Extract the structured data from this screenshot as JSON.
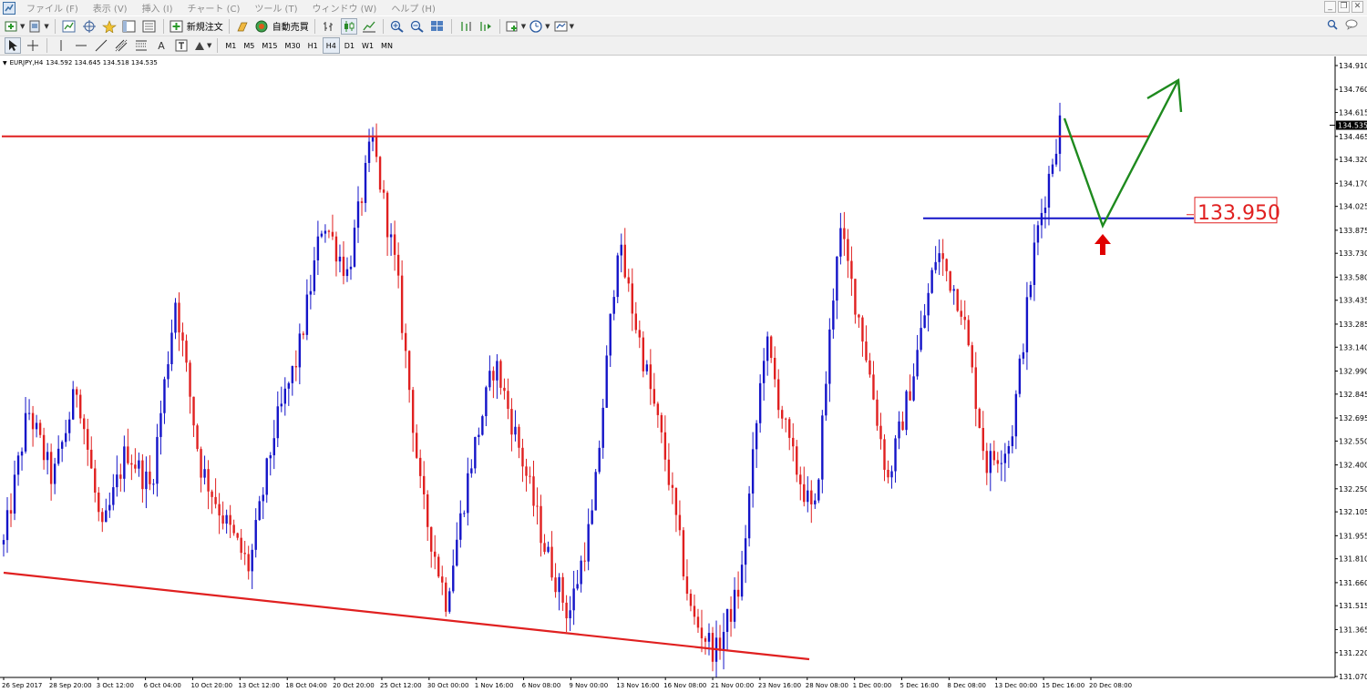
{
  "menu": {
    "items": [
      "ファイル (F)",
      "表示 (V)",
      "挿入 (I)",
      "チャート (C)",
      "ツール (T)",
      "ウィンドウ (W)",
      "ヘルプ (H)"
    ]
  },
  "toolbar1": {
    "new_order_label": "新規注文",
    "auto_trade_label": "自動売買"
  },
  "toolbar2": {
    "timeframes": [
      "M1",
      "M5",
      "M15",
      "M30",
      "H1",
      "H4",
      "D1",
      "W1",
      "MN"
    ],
    "active_timeframe": "H4",
    "text_tool_label": "A"
  },
  "chart_data": {
    "type": "candlestick",
    "symbol_label": "EURJPY,H4",
    "ohlc_label": "134.592 134.645 134.518 134.535",
    "current_price_label": "134.535",
    "current_price": 134.535,
    "price_axis_labels": [
      "134.910",
      "134.760",
      "134.615",
      "134.465",
      "134.320",
      "134.170",
      "134.025",
      "133.875",
      "133.730",
      "133.580",
      "133.435",
      "133.285",
      "133.140",
      "132.990",
      "132.845",
      "132.695",
      "132.550",
      "132.400",
      "132.250",
      "132.105",
      "131.955",
      "131.810",
      "131.660",
      "131.515",
      "131.365",
      "131.220",
      "131.070"
    ],
    "ylim": [
      131.07,
      134.91
    ],
    "time_axis_labels": [
      "26 Sep 2017",
      "28 Sep 20:00",
      "3 Oct 12:00",
      "6 Oct 04:00",
      "10 Oct 20:00",
      "13 Oct 12:00",
      "18 Oct 04:00",
      "20 Oct 20:00",
      "25 Oct 12:00",
      "30 Oct 00:00",
      "1 Nov 16:00",
      "6 Nov 08:00",
      "9 Nov 00:00",
      "13 Nov 16:00",
      "16 Nov 08:00",
      "21 Nov 00:00",
      "23 Nov 16:00",
      "28 Nov 08:00",
      "1 Dec 00:00",
      "5 Dec 16:00",
      "8 Dec 08:00",
      "13 Dec 00:00",
      "15 Dec 16:00",
      "20 Dec 08:00"
    ],
    "waypoints": [
      131.9,
      132.75,
      132.3,
      132.9,
      131.95,
      132.5,
      132.25,
      133.45,
      132.4,
      132.05,
      131.75,
      132.6,
      133.1,
      133.95,
      133.6,
      134.45,
      133.6,
      132.2,
      131.55,
      132.4,
      133.05,
      132.5,
      131.9,
      131.45,
      132.1,
      133.8,
      133.1,
      132.4,
      131.45,
      131.22,
      131.65,
      133.2,
      132.5,
      132.05,
      133.9,
      133.2,
      132.3,
      132.95,
      133.75,
      133.4,
      132.4,
      132.55,
      133.8,
      134.55
    ],
    "colors": {
      "bull": "#1414c8",
      "bear": "#e02020"
    },
    "annotations": {
      "support_level_label": "133.950",
      "support_level": 133.95,
      "resistance_level": 134.465
    }
  }
}
